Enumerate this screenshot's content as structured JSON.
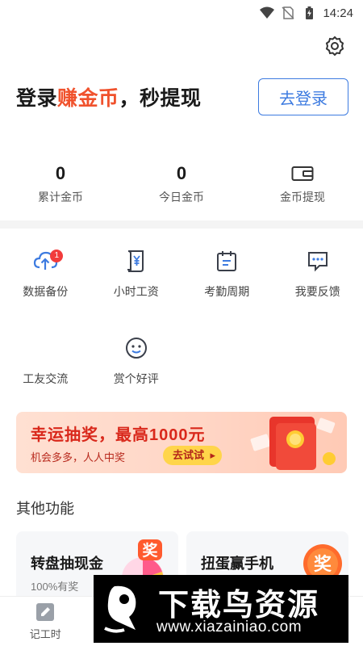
{
  "status_bar": {
    "time": "14:24"
  },
  "login": {
    "title_part1": "登录",
    "title_highlight": "赚金币",
    "title_part2": "，秒提现",
    "button_label": "去登录"
  },
  "stats": [
    {
      "value": "0",
      "label": "累计金币"
    },
    {
      "value": "0",
      "label": "今日金币"
    },
    {
      "label": "金币提现",
      "icon": "wallet-icon"
    }
  ],
  "tools": [
    {
      "label": "数据备份",
      "icon": "cloud-upload-icon",
      "badge": "1"
    },
    {
      "label": "小时工资",
      "icon": "yuan-scroll-icon"
    },
    {
      "label": "考勤周期",
      "icon": "calendar-icon"
    },
    {
      "label": "我要反馈",
      "icon": "feedback-icon"
    },
    {
      "label": "工友交流",
      "icon": ""
    },
    {
      "label": "赏个好评",
      "icon": "smiley-icon"
    }
  ],
  "banner": {
    "title": "幸运抽奖，最高1000元",
    "subtitle": "机会多多，人人中奖",
    "button_label": "去试试"
  },
  "section_title": "其他功能",
  "feature_cards": [
    {
      "title": "转盘抽现金",
      "subtitle": "100%有奖",
      "badge": "奖"
    },
    {
      "title": "扭蛋赢手机",
      "badge": "奖"
    }
  ],
  "tabbar": [
    {
      "label": "记工时",
      "icon": "edit-icon"
    }
  ],
  "watermark": {
    "title": "下载鸟资源",
    "url": "www.xiazainiao.com"
  },
  "colors": {
    "accent_orange": "#f0522d",
    "primary_blue": "#3d7be0",
    "icon_blue": "#3d7be0",
    "icon_dark": "#3a3f4a"
  }
}
